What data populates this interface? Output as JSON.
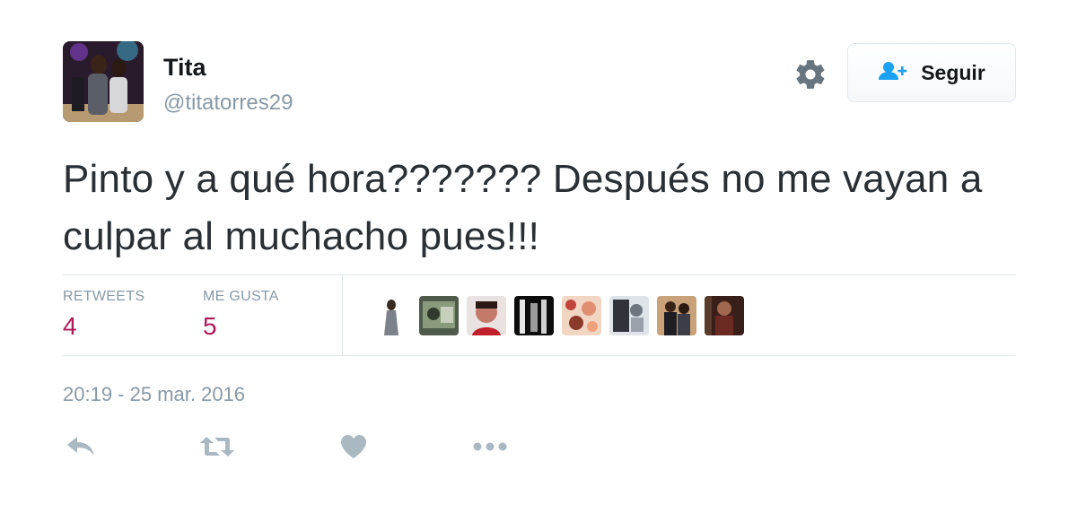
{
  "user": {
    "name": "Tita",
    "handle": "@titatorres29"
  },
  "header": {
    "settings_icon": "gear-icon",
    "follow_icon": "add-user-icon",
    "follow_label": "Seguir"
  },
  "tweet": {
    "text": "Pinto y a qué hora??????? Después no me vayan a culpar al muchacho pues!!!",
    "timestamp": "20:19 - 25 mar. 2016"
  },
  "stats": {
    "retweets_label": "RETWEETS",
    "retweets_count": "4",
    "likes_label": "ME GUSTA",
    "likes_count": "5"
  },
  "liker_avatars": 8,
  "actions": [
    "reply-icon",
    "retweet-icon",
    "like-icon",
    "more-icon"
  ],
  "colors": {
    "accent": "#ac1a55",
    "follow_icon": "#1da1f2",
    "muted": "#8899a6",
    "icon_gray": "#aab8c2"
  }
}
